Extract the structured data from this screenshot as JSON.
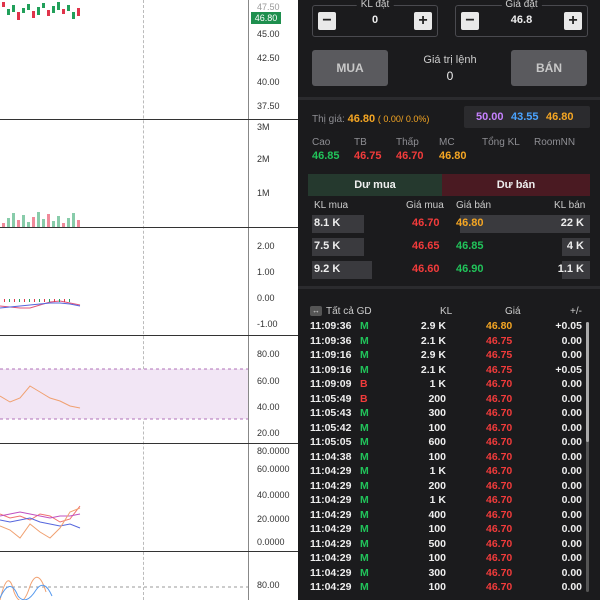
{
  "order": {
    "kl_label": "KL đặt",
    "kl_value": "0",
    "gia_label": "Giá đặt",
    "gia_value": "46.8",
    "minus": "−",
    "plus": "+",
    "buy_label": "MUA",
    "sell_label": "BÁN",
    "value_label": "Giá trị lệnh",
    "value": "0"
  },
  "quote": {
    "thi_gia_label": "Thị giá:",
    "thi_gia": "46.80",
    "change": "( 0.00/ 0.0%)",
    "ceiling": "50.00",
    "floor": "43.55",
    "ref": "46.80",
    "stats_labels": [
      "Cao",
      "TB",
      "Thấp",
      "MC",
      "Tổng KL",
      "RoomNN"
    ],
    "stats_values": [
      "46.85",
      "46.75",
      "46.70",
      "46.80"
    ],
    "tab_buy": "Dư mua",
    "tab_sell": "Dư bán",
    "headers": [
      "KL mua",
      "Giá mua",
      "Giá bán",
      "KL bán"
    ],
    "depth": [
      {
        "kl_mua": "8.1 K",
        "gia_mua": "46.70",
        "gia_ban": "46.80",
        "kl_ban": "22 K",
        "mua_w": 52,
        "ban_w": 130
      },
      {
        "kl_mua": "7.5 K",
        "gia_mua": "46.65",
        "gia_ban": "46.85",
        "kl_ban": "4 K",
        "mua_w": 52,
        "ban_w": 28
      },
      {
        "kl_mua": "9.2 K",
        "gia_mua": "46.60",
        "gia_ban": "46.90",
        "kl_ban": "1.1 K",
        "mua_w": 60,
        "ban_w": 28
      }
    ]
  },
  "trades": {
    "filter_icon": "toggle-icon",
    "headers": [
      "Tất cả GD",
      "KL",
      "Giá",
      "+/-"
    ],
    "rows": [
      {
        "time": "11:09:36",
        "side": "M",
        "kl": "2.9 K",
        "gia": "46.80",
        "chg": "+0.05"
      },
      {
        "time": "11:09:36",
        "side": "M",
        "kl": "2.1 K",
        "gia": "46.75",
        "chg": "0.00"
      },
      {
        "time": "11:09:16",
        "side": "M",
        "kl": "2.9 K",
        "gia": "46.75",
        "chg": "0.00"
      },
      {
        "time": "11:09:16",
        "side": "M",
        "kl": "2.1 K",
        "gia": "46.75",
        "chg": "+0.05"
      },
      {
        "time": "11:09:09",
        "side": "B",
        "kl": "1 K",
        "gia": "46.70",
        "chg": "0.00"
      },
      {
        "time": "11:05:49",
        "side": "B",
        "kl": "200",
        "gia": "46.70",
        "chg": "0.00"
      },
      {
        "time": "11:05:43",
        "side": "M",
        "kl": "300",
        "gia": "46.70",
        "chg": "0.00"
      },
      {
        "time": "11:05:42",
        "side": "M",
        "kl": "100",
        "gia": "46.70",
        "chg": "0.00"
      },
      {
        "time": "11:05:05",
        "side": "M",
        "kl": "600",
        "gia": "46.70",
        "chg": "0.00"
      },
      {
        "time": "11:04:38",
        "side": "M",
        "kl": "100",
        "gia": "46.70",
        "chg": "0.00"
      },
      {
        "time": "11:04:29",
        "side": "M",
        "kl": "1 K",
        "gia": "46.70",
        "chg": "0.00"
      },
      {
        "time": "11:04:29",
        "side": "M",
        "kl": "200",
        "gia": "46.70",
        "chg": "0.00"
      },
      {
        "time": "11:04:29",
        "side": "M",
        "kl": "1 K",
        "gia": "46.70",
        "chg": "0.00"
      },
      {
        "time": "11:04:29",
        "side": "M",
        "kl": "400",
        "gia": "46.70",
        "chg": "0.00"
      },
      {
        "time": "11:04:29",
        "side": "M",
        "kl": "100",
        "gia": "46.70",
        "chg": "0.00"
      },
      {
        "time": "11:04:29",
        "side": "M",
        "kl": "500",
        "gia": "46.70",
        "chg": "0.00"
      },
      {
        "time": "11:04:29",
        "side": "M",
        "kl": "100",
        "gia": "46.70",
        "chg": "0.00"
      },
      {
        "time": "11:04:29",
        "side": "M",
        "kl": "300",
        "gia": "46.70",
        "chg": "0.00"
      },
      {
        "time": "11:04:29",
        "side": "M",
        "kl": "100",
        "gia": "46.70",
        "chg": "0.00"
      }
    ]
  },
  "charts": {
    "price_ticks": [
      "47.50",
      "45.00",
      "42.50",
      "40.00",
      "37.50"
    ],
    "price_tag": "46.80",
    "volume_ticks": [
      "3M",
      "2M",
      "1M"
    ],
    "macd_ticks": [
      "2.00",
      "1.00",
      "0.00",
      "-1.00"
    ],
    "rsi_ticks": [
      "80.00",
      "60.00",
      "40.00",
      "20.00"
    ],
    "stoch_ticks": [
      "80.0000",
      "60.0000",
      "40.0000",
      "20.0000",
      "0.0000"
    ],
    "bottom_ticks": [
      "80.00"
    ]
  },
  "colors": {
    "up": "#21c35a",
    "down": "#f23b3b",
    "ref": "#f5a623",
    "ceiling": "#c681ff",
    "floor": "#4aa3ff"
  }
}
